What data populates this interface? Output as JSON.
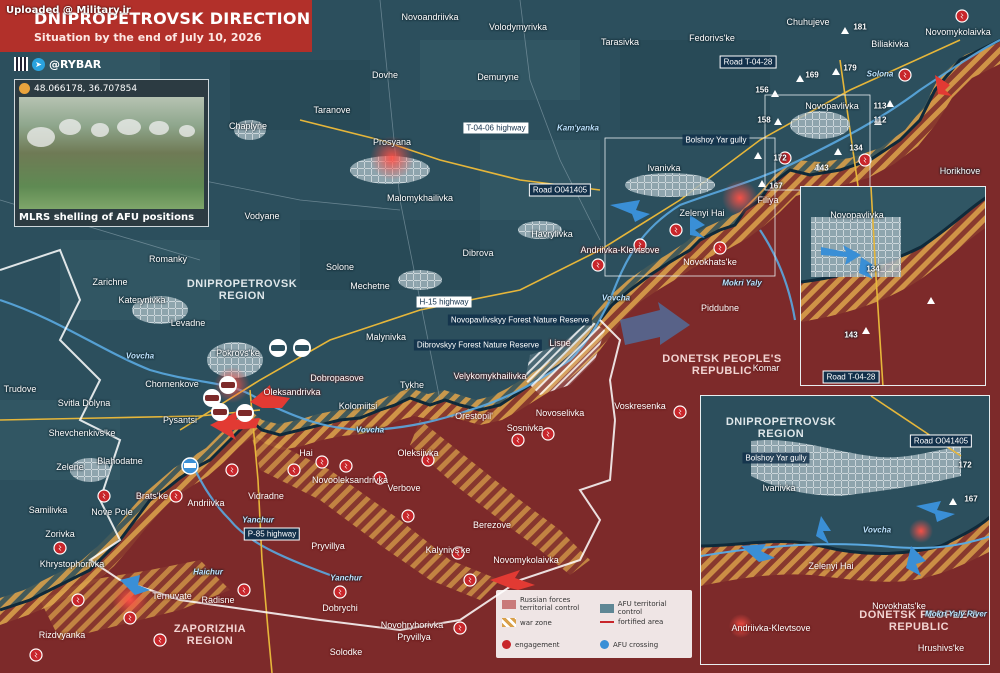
{
  "header": {
    "title": "DNIPROPETROVSK DIRECTION",
    "subtitle": "Situation by the end of July 10, 2026",
    "watermark": "Uploaded @ Military.ir",
    "brand": "@RYBAR"
  },
  "photo": {
    "coords": "48.066178, 36.707854",
    "caption": "MLRS shelling of AFU positions"
  },
  "colors": {
    "afu_land": "#2c4f5d",
    "russian_land": "#7d2a2a",
    "war_zone": "#d9a04a",
    "engagement": "#c8262b",
    "afu_arrow": "#3a8fd6",
    "russian_arrow": "#e23a33",
    "afu_line": "#0f2a3a",
    "road": "#e6b63a"
  },
  "regions": [
    {
      "label": "DNIPROPETROVSK REGION",
      "side": "afu"
    },
    {
      "label": "DONETSK PEOPLE'S REPUBLIC",
      "side": "ru"
    },
    {
      "label": "ZAPORIZHIA REGION",
      "side": "ru"
    }
  ],
  "settlements_afu": [
    "Novoandriivka",
    "Volodymyrivka",
    "Tarasivka",
    "Fedorivs'ke",
    "Chuhujeve",
    "Biliakivka",
    "Novomykolaivka",
    "Dovhe",
    "Demuryne",
    "Taranove",
    "Chaplyne",
    "Prosyana",
    "Malomykhailivka",
    "Ivanivka",
    "Horikhove",
    "Vodyane",
    "Havrylivka",
    "Zelenyi Hai",
    "Romanky",
    "Solone",
    "Dibrova",
    "Zarichne",
    "Katerynivka",
    "Mechetne",
    "Levadne",
    "Malynivka",
    "Pokrovs'ke",
    "Chornenkove",
    "Trudove",
    "Svitla Dolyna",
    "Pysantsi",
    "Shevchenkivs'ke",
    "Blahodatne",
    "Zelene",
    "Samilivka",
    "Zorivka",
    "Khrystophorivka",
    "Nove Pole",
    "Tykhe",
    "Kolomiitsi"
  ],
  "settlements_ru": [
    "Novopavlivka",
    "Filiya",
    "Andriivka-Klevtsove",
    "Novokhats'ke",
    "Piddubne",
    "Komar",
    "Lisne",
    "Velykomykhailivka",
    "Oleksandrivka",
    "Dobropasove",
    "Orestopil'",
    "Novoselivka",
    "Voskresenka",
    "Sosnivka",
    "Hai",
    "Oleksiivka",
    "Novooleksandrivka",
    "Vidradne",
    "Andriivka",
    "Brats'ke",
    "Verbove",
    "Berezove",
    "Kalynivs'ke",
    "Novomykolaivka",
    "Pryvillya",
    "Dobrychi",
    "Ternuvate",
    "Radisne",
    "Rizdvyanka",
    "Novohryhorivka",
    "Solodke"
  ],
  "rivers": [
    "Vovcha",
    "Vovcha",
    "Vovcha",
    "Mokri Yaly",
    "Yanchur",
    "Haichur",
    "Yanchur",
    "Solona"
  ],
  "roads": [
    "T-04-06 highway",
    "Road O041405",
    "Road T-04-28",
    "H-15 highway",
    "P-85 highway",
    "Kam'yanka"
  ],
  "forests": [
    "Novopavlivskyy Forest Nature Reserve",
    "Dibrovskyy Forest Nature Reserve"
  ],
  "elevations": [
    "181",
    "179",
    "169",
    "156",
    "158",
    "172",
    "112",
    "113",
    "134",
    "143",
    "167"
  ],
  "gully": "Bolshoy Yar gully",
  "inset_a": {
    "settlement": "Novopavlivka",
    "road": "Road T-04-28",
    "elevations": [
      "134",
      "143"
    ]
  },
  "inset_b": {
    "region": "DNIPROPETROVSK REGION",
    "region2": "DONETSK PEOPLE'S REPUBLIC",
    "gully": "Bolshoy Yar gully",
    "road": "Road O041405",
    "settlements": [
      "Ivanivka",
      "Zelenyi Hai",
      "Andriivka-Klevtsove",
      "Novokhats'ke",
      "Hrushivs'ke"
    ],
    "rivers": [
      "Vovcha",
      "Mokri Yaly River"
    ],
    "elevations": [
      "172",
      "167"
    ]
  },
  "legend": {
    "ru_control": "Russian forces territorial control",
    "afu_control": "AFU territorial control",
    "war_zone": "war zone",
    "fortified": "fortified area",
    "engagement": "engagement",
    "crossing": "AFU crossing"
  }
}
